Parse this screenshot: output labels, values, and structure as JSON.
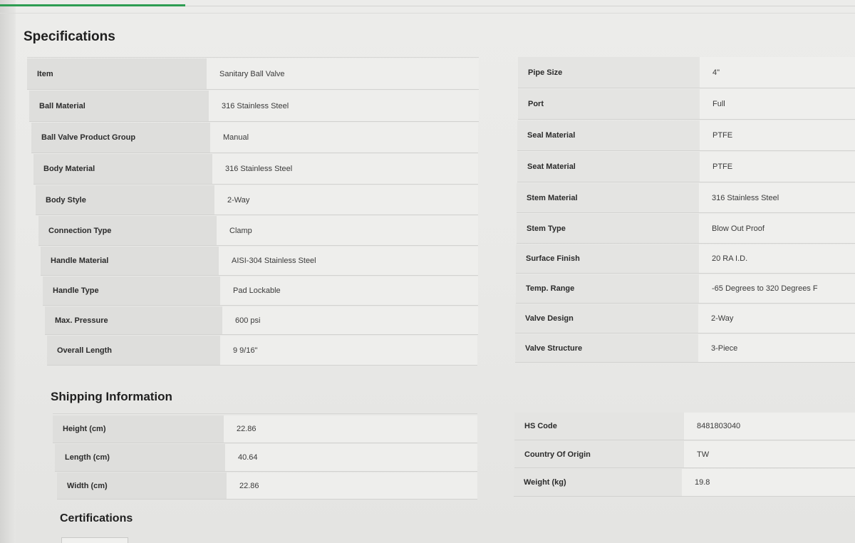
{
  "sections": {
    "specifications": "Specifications",
    "shipping": "Shipping Information",
    "certifications": "Certifications"
  },
  "spec_left": [
    {
      "key": "Item",
      "value": "Sanitary Ball Valve"
    },
    {
      "key": "Ball Material",
      "value": "316 Stainless Steel"
    },
    {
      "key": "Ball Valve Product Group",
      "value": "Manual"
    },
    {
      "key": "Body Material",
      "value": "316 Stainless Steel"
    },
    {
      "key": "Body Style",
      "value": "2-Way"
    },
    {
      "key": "Connection Type",
      "value": "Clamp"
    },
    {
      "key": "Handle Material",
      "value": "AISI-304 Stainless Steel"
    },
    {
      "key": "Handle Type",
      "value": "Pad Lockable"
    },
    {
      "key": "Max. Pressure",
      "value": "600 psi"
    },
    {
      "key": "Overall Length",
      "value": "9 9/16\""
    }
  ],
  "spec_right": [
    {
      "key": "Pipe Size",
      "value": "4\""
    },
    {
      "key": "Port",
      "value": "Full"
    },
    {
      "key": "Seal Material",
      "value": "PTFE"
    },
    {
      "key": "Seat Material",
      "value": "PTFE"
    },
    {
      "key": "Stem Material",
      "value": "316 Stainless Steel"
    },
    {
      "key": "Stem Type",
      "value": "Blow Out Proof"
    },
    {
      "key": "Surface Finish",
      "value": "20 RA I.D."
    },
    {
      "key": "Temp. Range",
      "value": "-65 Degrees to 320 Degrees F"
    },
    {
      "key": "Valve Design",
      "value": "2-Way"
    },
    {
      "key": "Valve Structure",
      "value": "3-Piece"
    }
  ],
  "ship_left": [
    {
      "key": "Height (cm)",
      "value": "22.86"
    },
    {
      "key": "Length (cm)",
      "value": "40.64"
    },
    {
      "key": "Width (cm)",
      "value": "22.86"
    }
  ],
  "ship_right": [
    {
      "key": "HS Code",
      "value": "8481803040"
    },
    {
      "key": "Country Of Origin",
      "value": "TW"
    },
    {
      "key": "Weight (kg)",
      "value": "19.8"
    }
  ],
  "colors": {
    "progress": "#2e9d52",
    "key_bg": "#dededc",
    "value_bg": "#eeeeec"
  }
}
